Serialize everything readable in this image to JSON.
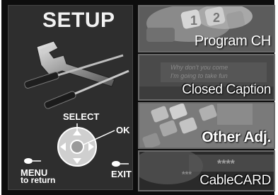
{
  "setup": {
    "title": "SETUP",
    "select_label": "SELECT",
    "ok_label": "OK",
    "menu_label": "MENU",
    "return_label": "to return",
    "exit_label": "EXIT"
  },
  "menu": {
    "items": [
      {
        "label": "Program CH"
      },
      {
        "label": "Closed Caption",
        "background_text_1": "Why don't you come",
        "background_text_2": "I'm going to take fun"
      },
      {
        "label": "Other Adj."
      },
      {
        "label": "CableCARD"
      }
    ]
  },
  "colors": {
    "frame": "#0d0d0d",
    "panel": "#2e2e2e",
    "tile_border": "#6a6a6a",
    "text": "#ffffff"
  },
  "icons": [
    "wrench-icon",
    "screwdriver-icon",
    "dpad-icon",
    "menu-button-icon",
    "exit-button-icon"
  ]
}
